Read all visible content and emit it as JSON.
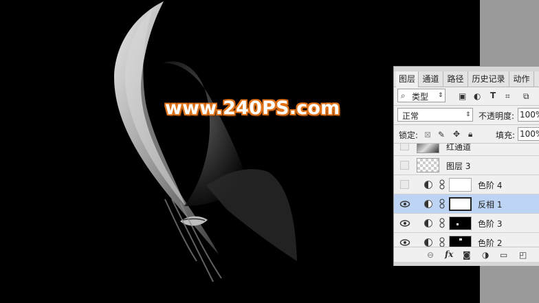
{
  "watermark": "www.240PS.com",
  "panel": {
    "tabs": [
      "图层",
      "通道",
      "路径",
      "历史记录",
      "动作"
    ],
    "filter": {
      "icon": "search-icon",
      "label": "类型"
    },
    "blend_mode": "正常",
    "opacity_label": "不透明度:",
    "opacity_value": "100%",
    "lock_label": "锁定:",
    "fill_label": "填充:",
    "fill_value": "100%",
    "layers": [
      {
        "name": "红通道",
        "visible": false,
        "type": "image"
      },
      {
        "name": "图层 3",
        "visible": false,
        "type": "transparent"
      },
      {
        "name": "色阶 4",
        "visible": false,
        "type": "adjustment",
        "mask": "white"
      },
      {
        "name": "反相 1",
        "visible": true,
        "type": "adjustment",
        "mask": "white",
        "selected": true
      },
      {
        "name": "色阶 3",
        "visible": true,
        "type": "adjustment",
        "mask": "black"
      },
      {
        "name": "色阶 2",
        "visible": true,
        "type": "adjustment",
        "mask": "black"
      }
    ],
    "footer_icons": [
      "link-icon",
      "fx-icon",
      "mask-icon",
      "adjustment-icon",
      "folder-icon",
      "new-layer-icon"
    ]
  },
  "colors": {
    "selected_layer": "#bdd4f5",
    "watermark_outline": "#e0731a"
  }
}
